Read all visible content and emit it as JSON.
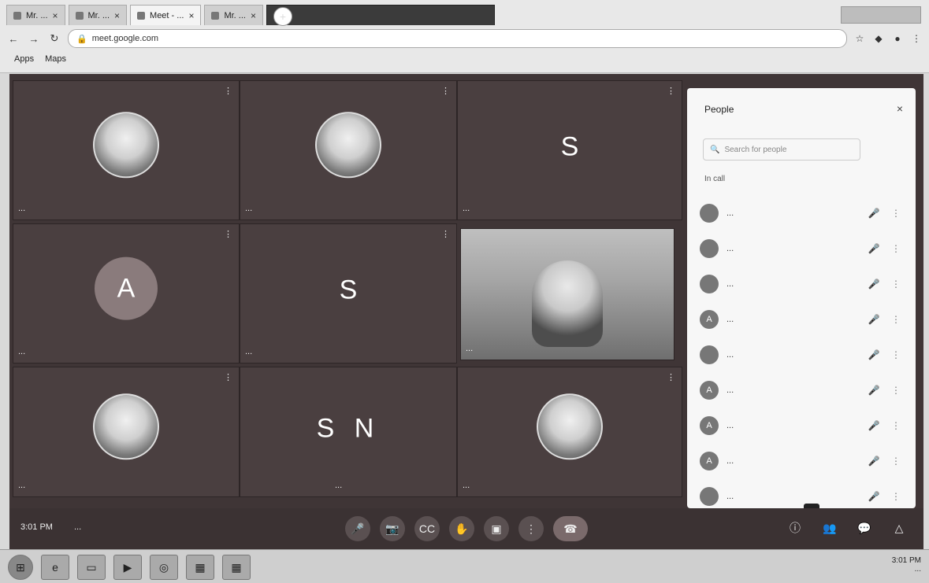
{
  "browser": {
    "tabs": [
      {
        "label": "Mr. ...",
        "active": false
      },
      {
        "label": "Mr. ...",
        "active": false
      },
      {
        "label": "Meet - ...",
        "active": true
      },
      {
        "label": "Mr. ...",
        "active": false
      }
    ],
    "new_tab_glyph": "+",
    "address": "meet.google.com",
    "bookmarks": [
      "Apps",
      "Maps"
    ]
  },
  "meeting": {
    "tiles": [
      {
        "id": "t1",
        "name": "...",
        "kind": "photo"
      },
      {
        "id": "t2",
        "name": "...",
        "kind": "photo"
      },
      {
        "id": "t3",
        "name": "...",
        "kind": "letter",
        "letter": "S"
      },
      {
        "id": "t4",
        "name": "...",
        "kind": "letter",
        "letter": "A"
      },
      {
        "id": "t5",
        "name": "...",
        "kind": "letter",
        "letter": "S"
      },
      {
        "id": "t6",
        "name": "...",
        "kind": "video"
      },
      {
        "id": "t7",
        "name": "...",
        "kind": "photo"
      },
      {
        "id": "t8",
        "name": "...",
        "kind": "letters",
        "letters": "S N"
      },
      {
        "id": "t9",
        "name": "...",
        "kind": "photo"
      }
    ],
    "time": "3:01 PM",
    "meeting_code": "..."
  },
  "people_panel": {
    "title": "People",
    "close": "×",
    "search_placeholder": "Search for people",
    "section_label": "In call",
    "participants": [
      {
        "name": "...",
        "initial": "",
        "avatar": "photo"
      },
      {
        "name": "...",
        "initial": "",
        "avatar": "photo"
      },
      {
        "name": "...",
        "initial": "",
        "avatar": "photo"
      },
      {
        "name": "...",
        "initial": "A",
        "avatar": "letter"
      },
      {
        "name": "...",
        "initial": "",
        "avatar": "photo"
      },
      {
        "name": "...",
        "initial": "A",
        "avatar": "letter"
      },
      {
        "name": "...",
        "initial": "A",
        "avatar": "letter"
      },
      {
        "name": "...",
        "initial": "A",
        "avatar": "letter"
      },
      {
        "name": "...",
        "initial": "",
        "avatar": "photo"
      }
    ]
  },
  "controls": {
    "buttons": [
      "mic-off",
      "camera",
      "captions",
      "raise-hand",
      "present",
      "more",
      "end-call"
    ],
    "right": [
      "info",
      "people",
      "chat",
      "activities"
    ],
    "tooltip": "..."
  },
  "taskbar": {
    "clock_line1": "3:01 PM",
    "clock_line2": "..."
  }
}
